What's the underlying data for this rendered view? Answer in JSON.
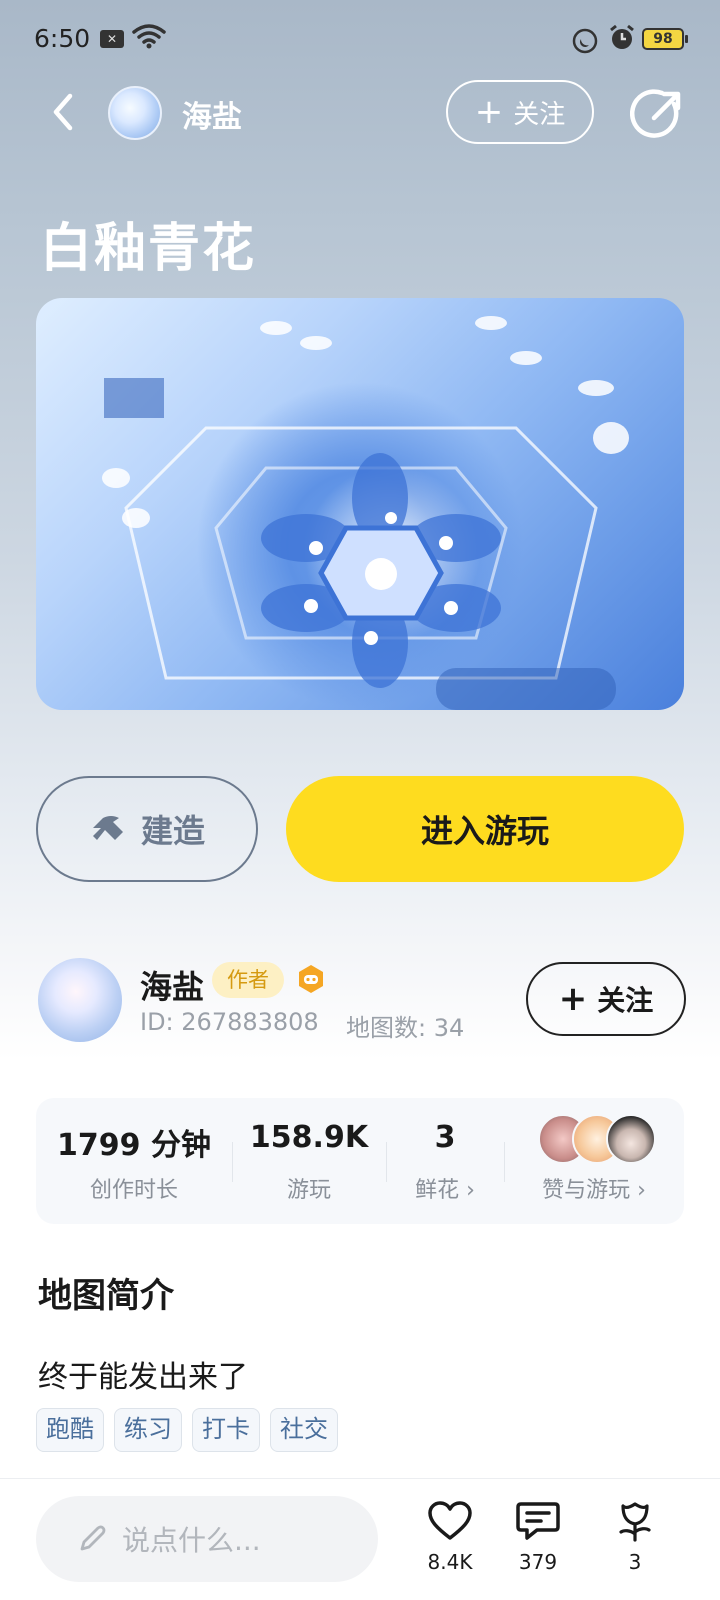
{
  "status_bar": {
    "time": "6:50",
    "battery": "98"
  },
  "header": {
    "author": "海盐",
    "follow_label": "关注"
  },
  "map": {
    "title": "白釉青花"
  },
  "actions": {
    "build_label": "建造",
    "play_label": "进入游玩"
  },
  "author": {
    "name": "海盐",
    "role_tag": "作者",
    "id_text": "ID: 267883808",
    "map_count_text": "地图数: 34",
    "follow_label": "关注"
  },
  "stats": [
    {
      "value": "1799 分钟",
      "label": "创作时长"
    },
    {
      "value": "158.9K",
      "label": "游玩"
    },
    {
      "value": "3",
      "label": "鲜花 ›"
    },
    {
      "label": "赞与游玩 ›"
    }
  ],
  "intro": {
    "title": "地图简介",
    "text": "终于能发出来了",
    "tags": [
      "跑酷",
      "练习",
      "打卡",
      "社交"
    ]
  },
  "bottom_bar": {
    "comment_placeholder": "说点什么...",
    "likes": "8.4K",
    "comments": "379",
    "flowers": "3"
  },
  "colors": {
    "accent_yellow": "#fedc1f",
    "tag_text": "#4a6f9c"
  }
}
